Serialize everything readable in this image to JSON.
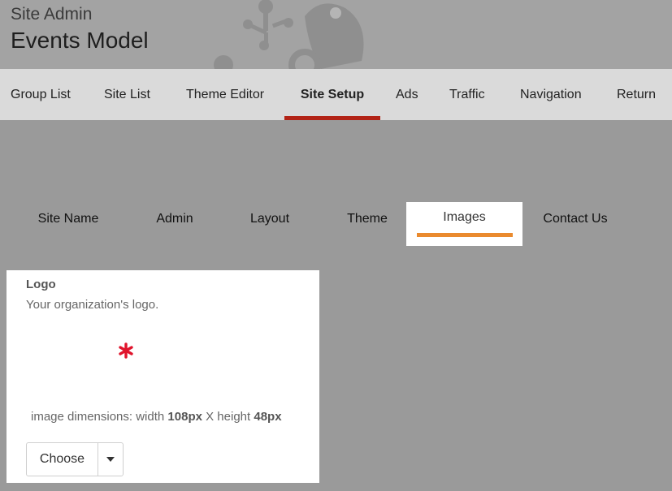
{
  "header": {
    "subtitle": "Site Admin",
    "title": "Events Model",
    "brand_icon": "frog-logo-graphic"
  },
  "topnav": {
    "items": [
      {
        "label": "Group List",
        "active": false
      },
      {
        "label": "Site List",
        "active": false
      },
      {
        "label": "Theme Editor",
        "active": false
      },
      {
        "label": "Site Setup",
        "active": true
      },
      {
        "label": "Ads",
        "active": false
      },
      {
        "label": "Traffic",
        "active": false
      },
      {
        "label": "Navigation",
        "active": false
      },
      {
        "label": "Return",
        "active": false
      }
    ]
  },
  "subtabs": {
    "items": [
      {
        "label": "Site Name",
        "active": false
      },
      {
        "label": "Admin",
        "active": false
      },
      {
        "label": "Layout",
        "active": false
      },
      {
        "label": "Theme",
        "active": false
      },
      {
        "label": "Images",
        "active": true
      },
      {
        "label": "Contact Us",
        "active": false
      }
    ]
  },
  "logo_card": {
    "title": "Logo",
    "description": "Your organization's logo.",
    "required_icon": "asterisk-icon",
    "dims_prefix": "image dimensions: width ",
    "width_value": "108px",
    "dims_mid": " X height ",
    "height_value": "48px",
    "choose_label": "Choose",
    "caret_icon": "caret-down-icon"
  },
  "colors": {
    "page_bg": "#9a9a9a",
    "nav_bg": "#dadada",
    "active_nav_underline": "#b22316",
    "active_tab_underline": "#ea8a2e",
    "required_mark": "#e0142c"
  }
}
